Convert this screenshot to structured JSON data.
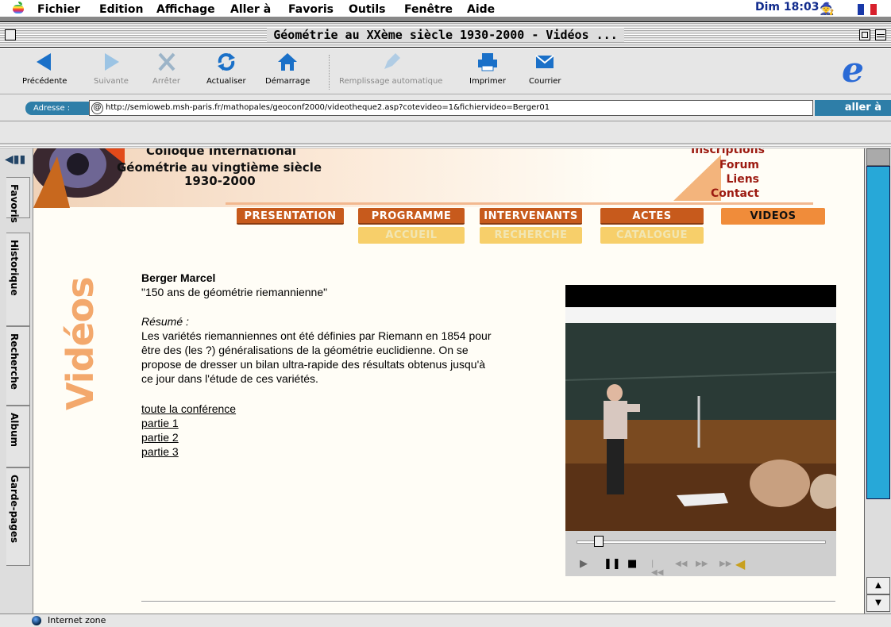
{
  "menubar": {
    "menus": [
      "Fichier",
      "Edition",
      "Affichage",
      "Aller à",
      "Favoris",
      "Outils",
      "Fenêtre",
      "Aide"
    ],
    "clock": "Dim 18:03"
  },
  "window": {
    "title": "Géométrie au XXème siècle 1930-2000 - Vidéos ..."
  },
  "toolbar": {
    "back": "Précédente",
    "forward": "Suivante",
    "stop": "Arrêter",
    "refresh": "Actualiser",
    "home": "Démarrage",
    "autofill": "Remplissage automatique",
    "print": "Imprimer",
    "mail": "Courrier"
  },
  "address": {
    "label": "Adresse :",
    "url": "http://semioweb.msh-paris.fr/mathopales/geoconf2000/videotheque2.asp?cotevideo=1&fichiervideo=Berger01",
    "go": "aller à"
  },
  "explorer_tabs": [
    "Favoris",
    "Historique",
    "Recherche",
    "Album",
    "Garde-pages"
  ],
  "site": {
    "header": {
      "line1": "Colloque International",
      "line2": "Géométrie au vingtième siècle",
      "line3": "1930-2000"
    },
    "toplinks": [
      "Inscriptions",
      "Forum",
      "Liens",
      "Contact"
    ],
    "nav_main": [
      "PRESENTATION",
      "PROGRAMME",
      "INTERVENANTS",
      "ACTES",
      "VIDEOS"
    ],
    "nav_sub": [
      "ACCUEIL",
      "RECHERCHE",
      "CATALOGUE"
    ],
    "section_title": "Vidéos"
  },
  "talk": {
    "author": "Berger  Marcel",
    "title": "\"150 ans de géométrie riemannienne\"",
    "resume_label": "Résumé :",
    "resume": [
      "Les variétés riemanniennes ont été définies par Riemann en 1854 pour",
      "être des (les ?) généralisations de la géométrie euclidienne. On se",
      "propose de dresser un bilan ultra-rapide des résultats obtenus jusqu'à",
      "ce jour dans l'étude de ces variétés."
    ],
    "links": [
      "toute la conférence",
      "partie 1",
      "partie 2",
      "partie 3"
    ]
  },
  "player": {
    "position": 0.09
  },
  "status": {
    "zone": "Internet zone"
  }
}
